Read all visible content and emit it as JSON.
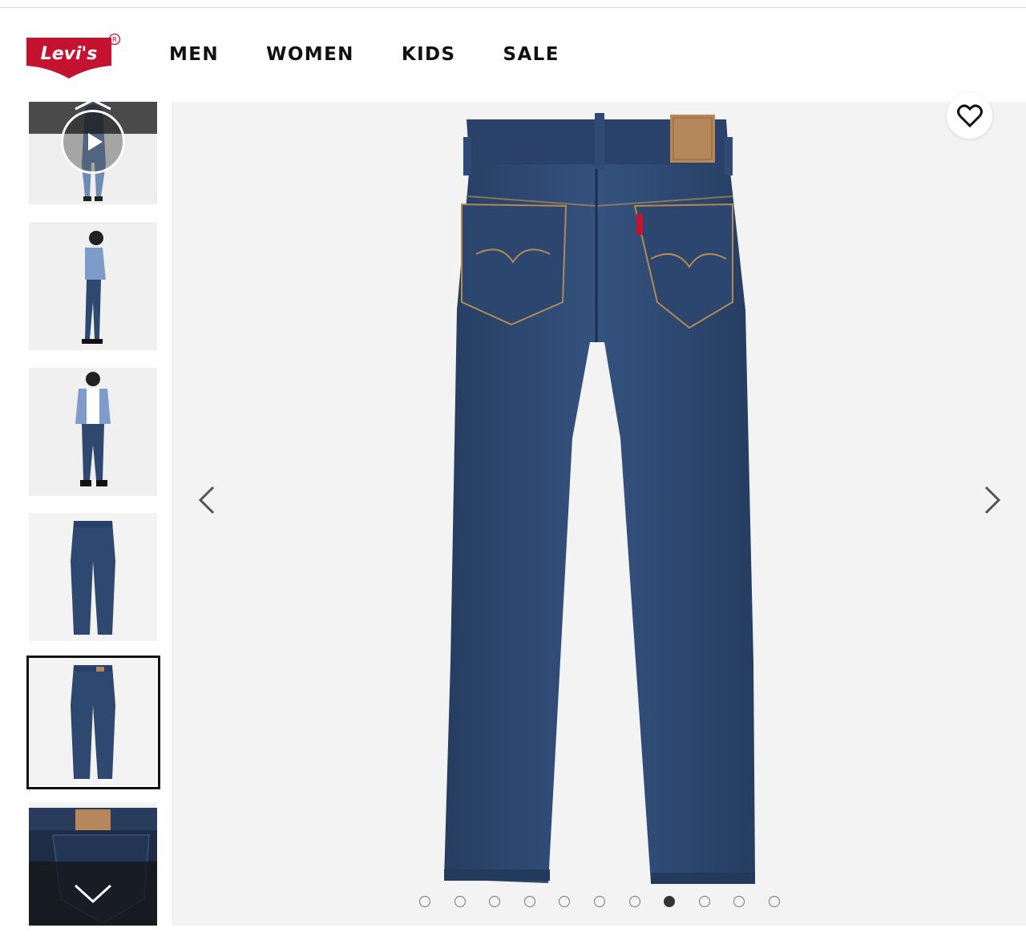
{
  "brand": {
    "logo_text": "Levi's",
    "logo_color": "#c41230"
  },
  "nav": {
    "items": [
      {
        "label": "MEN"
      },
      {
        "label": "WOMEN"
      },
      {
        "label": "KIDS"
      },
      {
        "label": "SALE"
      }
    ]
  },
  "gallery": {
    "thumbnails": [
      {
        "kind": "video",
        "icon": "play-icon"
      },
      {
        "kind": "image"
      },
      {
        "kind": "image"
      },
      {
        "kind": "image"
      },
      {
        "kind": "image",
        "selected": true
      },
      {
        "kind": "image"
      }
    ],
    "scroll_up_icon": "chevron-up-icon",
    "scroll_down_icon": "chevron-down-icon",
    "prev_icon": "chevron-left-icon",
    "next_icon": "chevron-right-icon",
    "wishlist_icon": "heart-icon",
    "total_slides": 11,
    "active_slide": 8,
    "denim_color": "#2e4870"
  }
}
